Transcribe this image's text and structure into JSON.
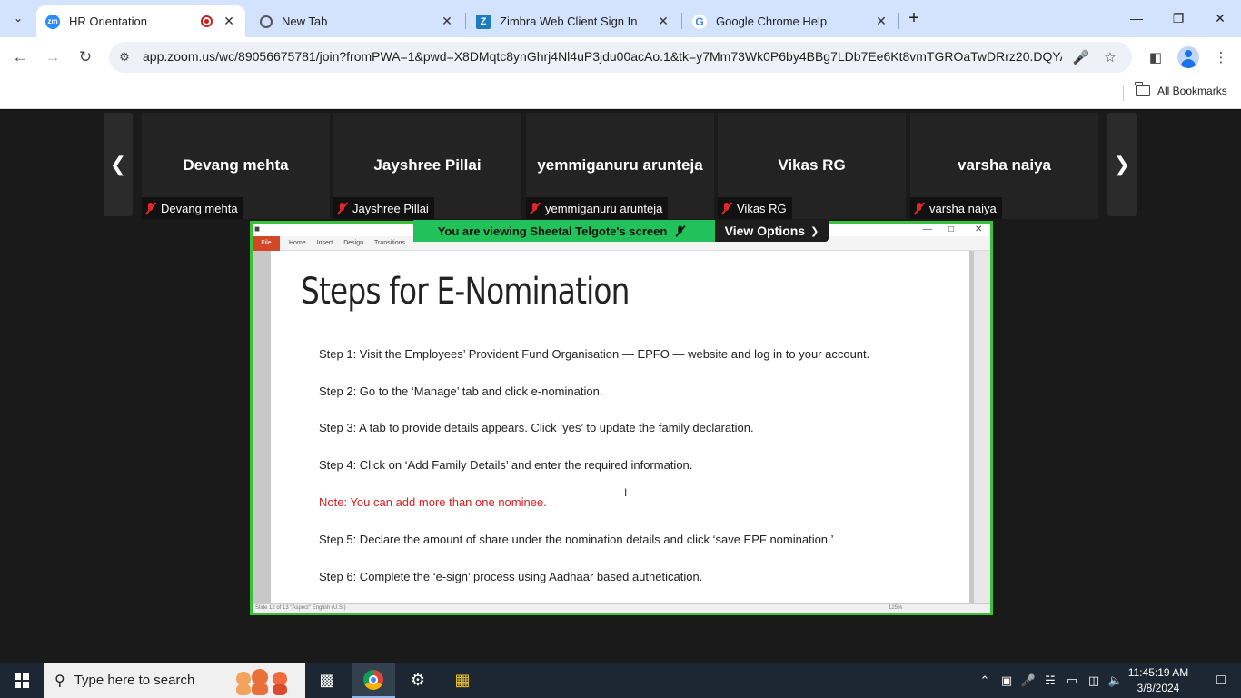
{
  "browser": {
    "tabs": [
      {
        "label": "HR Orientation",
        "favicon": "zm",
        "recording": true
      },
      {
        "label": "New Tab"
      },
      {
        "label": "Zimbra Web Client Sign In",
        "favicon": "Z"
      },
      {
        "label": "Google Chrome Help",
        "favicon": "G"
      }
    ],
    "url": "app.zoom.us/wc/89056675781/join?fromPWA=1&pwd=X8DMqtc8ynGhrj4Nl4uP3jdu00acAo.1&tk=y7Mm73Wk0P6by4BBg7LDb7Ee6Kt8vmTGROaTwDRrz20.DQYA...",
    "bookmarks_label": "All Bookmarks",
    "accent": "#d3e3fd"
  },
  "zoom": {
    "participants": [
      {
        "name": "Devang mehta"
      },
      {
        "name": "Jayshree Pillai"
      },
      {
        "name": "yemmiganuru arunteja"
      },
      {
        "name": "Vikas RG"
      },
      {
        "name": "varsha naiya"
      }
    ],
    "banner": "You are viewing  Sheetal Telgote's screen",
    "view_options": "View Options",
    "share_border_color": "#3bc23b"
  },
  "ppt": {
    "file_tab": "File",
    "ribbon_tabs": [
      "Home",
      "Insert",
      "Design",
      "Transitions"
    ],
    "status": "Slide 12 of 13   \"Aspect\"   English (U.S.)",
    "zoom_level": "125%"
  },
  "slide": {
    "title": "Steps for E-Nomination",
    "steps": [
      "Step 1: Visit the Employees’ Provident Fund Organisation — EPFO — website and log in to your account.",
      "Step 2: Go to the ‘Manage’ tab and click e-nomination.",
      "Step 3: A tab to provide details appears. Click ‘yes’ to update the family declaration.",
      "Step 4: Click on ‘Add Family Details’ and enter the required information.",
      "Note: You can add more than one nominee.",
      "Step 5: Declare the amount of share under the nomination details and click ‘save EPF nomination.’",
      "Step 6: Complete the ‘e-sign’ process using Aadhaar based authetication."
    ],
    "note_color": "#d62020"
  },
  "taskbar": {
    "search_placeholder": "Type here to search",
    "time": "11:45:19 AM",
    "date": "3/8/2024"
  }
}
